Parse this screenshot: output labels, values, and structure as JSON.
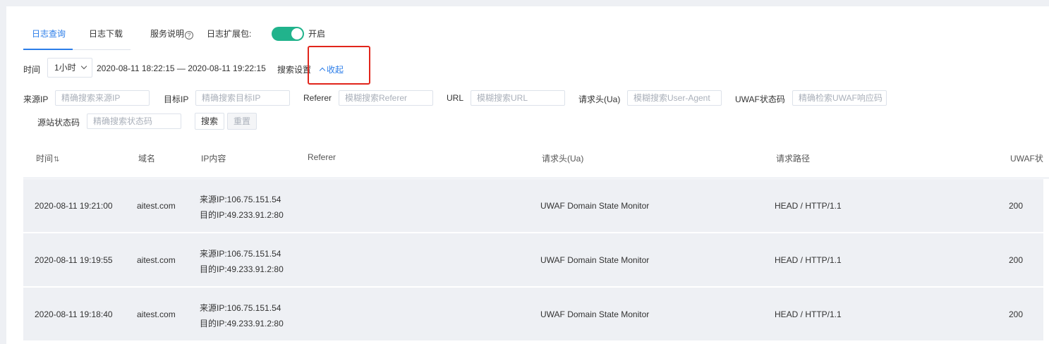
{
  "tabs": [
    {
      "label": "日志查询",
      "active": true
    },
    {
      "label": "日志下载",
      "active": false
    }
  ],
  "service_desc": "服务说明",
  "help_symbol": "?",
  "ext_pack_label": "日志扩展包:",
  "ext_pack_state": "开启",
  "accent": "#2b7de9",
  "toggle_color": "#21b38c",
  "time": {
    "label": "时间",
    "selected": "1小时",
    "range": "2020-08-11 18:22:15 — 2020-08-11 19:22:15",
    "search_setting": "搜索设置",
    "collapse": "收起"
  },
  "filters": [
    {
      "label": "来源IP",
      "placeholder": "精确搜索来源IP"
    },
    {
      "label": "目标IP",
      "placeholder": "精确搜索目标IP"
    },
    {
      "label": "Referer",
      "placeholder": "模糊搜索Referer"
    },
    {
      "label": "URL",
      "placeholder": "模糊搜索URL"
    },
    {
      "label": "请求头(Ua)",
      "placeholder": "模糊搜索User-Agent"
    },
    {
      "label": "UWAF状态码",
      "placeholder": "精确检索UWAF响应码"
    },
    {
      "label": "源站状态码",
      "placeholder": "精确搜索状态码"
    }
  ],
  "buttons": {
    "search": "搜索",
    "reset": "重置"
  },
  "table": {
    "headers": [
      "时间",
      "域名",
      "IP内容",
      "Referer",
      "请求头(Ua)",
      "请求路径",
      "UWAF状"
    ],
    "sort_icon": "⇅",
    "rows": [
      {
        "time": "2020-08-11 19:21:00",
        "domain": "aitest.com",
        "src": "来源IP:106.75.151.54",
        "dst": "目的IP:49.233.91.2:80",
        "referer": "",
        "ua": "UWAF Domain State Monitor",
        "path": "HEAD / HTTP/1.1",
        "status": "200"
      },
      {
        "time": "2020-08-11 19:19:55",
        "domain": "aitest.com",
        "src": "来源IP:106.75.151.54",
        "dst": "目的IP:49.233.91.2:80",
        "referer": "",
        "ua": "UWAF Domain State Monitor",
        "path": "HEAD / HTTP/1.1",
        "status": "200"
      },
      {
        "time": "2020-08-11 19:18:40",
        "domain": "aitest.com",
        "src": "来源IP:106.75.151.54",
        "dst": "目的IP:49.233.91.2:80",
        "referer": "",
        "ua": "UWAF Domain State Monitor",
        "path": "HEAD / HTTP/1.1",
        "status": "200"
      }
    ]
  }
}
